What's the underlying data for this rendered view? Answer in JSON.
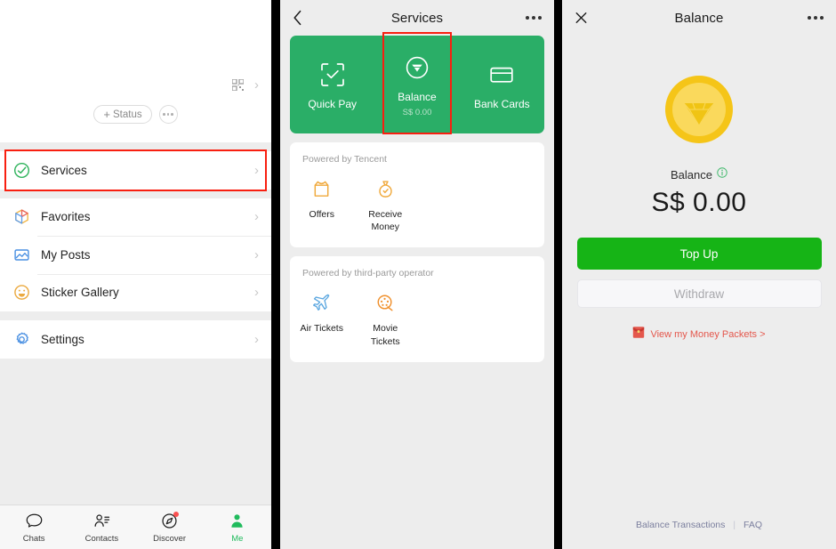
{
  "colors": {
    "wechat_green": "#2aae67",
    "button_green": "#16b416",
    "highlight_red": "#f81f10",
    "page_bg": "#ededed",
    "gold": "#f5c518",
    "link_blue_gray": "#7b7f9e"
  },
  "me_panel": {
    "qr_icon": "qr-code-icon",
    "chevron": "›",
    "status": {
      "plus": "+",
      "label": "Status",
      "more_icon": "more-dots-icon"
    },
    "groups": [
      {
        "items": [
          {
            "icon": "services-check-circle-icon",
            "label": "Services",
            "highlighted": true
          }
        ]
      },
      {
        "items": [
          {
            "icon": "favorites-cube-icon",
            "label": "Favorites",
            "highlighted": false
          },
          {
            "icon": "my-posts-photo-icon",
            "label": "My Posts",
            "highlighted": false
          },
          {
            "icon": "sticker-gallery-smiley-icon",
            "label": "Sticker Gallery",
            "highlighted": false
          }
        ]
      },
      {
        "items": [
          {
            "icon": "settings-gear-icon",
            "label": "Settings",
            "highlighted": false
          }
        ]
      }
    ],
    "tabbar": [
      {
        "icon": "chats-bubble-icon",
        "label": "Chats",
        "active": false,
        "badge": false
      },
      {
        "icon": "contacts-person-list-icon",
        "label": "Contacts",
        "active": false,
        "badge": false
      },
      {
        "icon": "discover-compass-icon",
        "label": "Discover",
        "active": false,
        "badge": true
      },
      {
        "icon": "me-person-icon",
        "label": "Me",
        "active": true,
        "badge": false
      }
    ]
  },
  "services_panel": {
    "nav": {
      "back_icon": "back-chevron-icon",
      "title": "Services",
      "more_icon": "more-dots-icon"
    },
    "green_card": [
      {
        "icon": "quick-pay-scan-icon",
        "label": "Quick Pay",
        "sub": "",
        "highlighted": false
      },
      {
        "icon": "balance-gem-circle-icon",
        "label": "Balance",
        "sub": "S$ 0.00",
        "highlighted": true
      },
      {
        "icon": "bank-cards-icon",
        "label": "Bank Cards",
        "sub": "",
        "highlighted": false
      }
    ],
    "sections": [
      {
        "title": "Powered by Tencent",
        "tiles": [
          {
            "icon": "offers-gift-icon",
            "label": "Offers"
          },
          {
            "icon": "receive-money-bag-icon",
            "label": "Receive\nMoney"
          }
        ]
      },
      {
        "title": "Powered by third-party operator",
        "tiles": [
          {
            "icon": "air-tickets-plane-icon",
            "label": "Air Tickets"
          },
          {
            "icon": "movie-tickets-reel-icon",
            "label": "Movie\nTickets"
          }
        ]
      }
    ]
  },
  "balance_panel": {
    "nav": {
      "close_icon": "close-x-icon",
      "title": "Balance",
      "more_icon": "more-dots-icon"
    },
    "coin_icon": "gold-coin-gem-icon",
    "balance_label": "Balance",
    "info_icon": "info-circle-icon",
    "amount": "S$ 0.00",
    "top_up_label": "Top Up",
    "withdraw_label": "Withdraw",
    "money_packets": {
      "icon": "red-packet-icon",
      "label": "View my Money Packets >"
    },
    "footer": {
      "transactions": "Balance Transactions",
      "separator": "|",
      "faq": "FAQ"
    }
  }
}
